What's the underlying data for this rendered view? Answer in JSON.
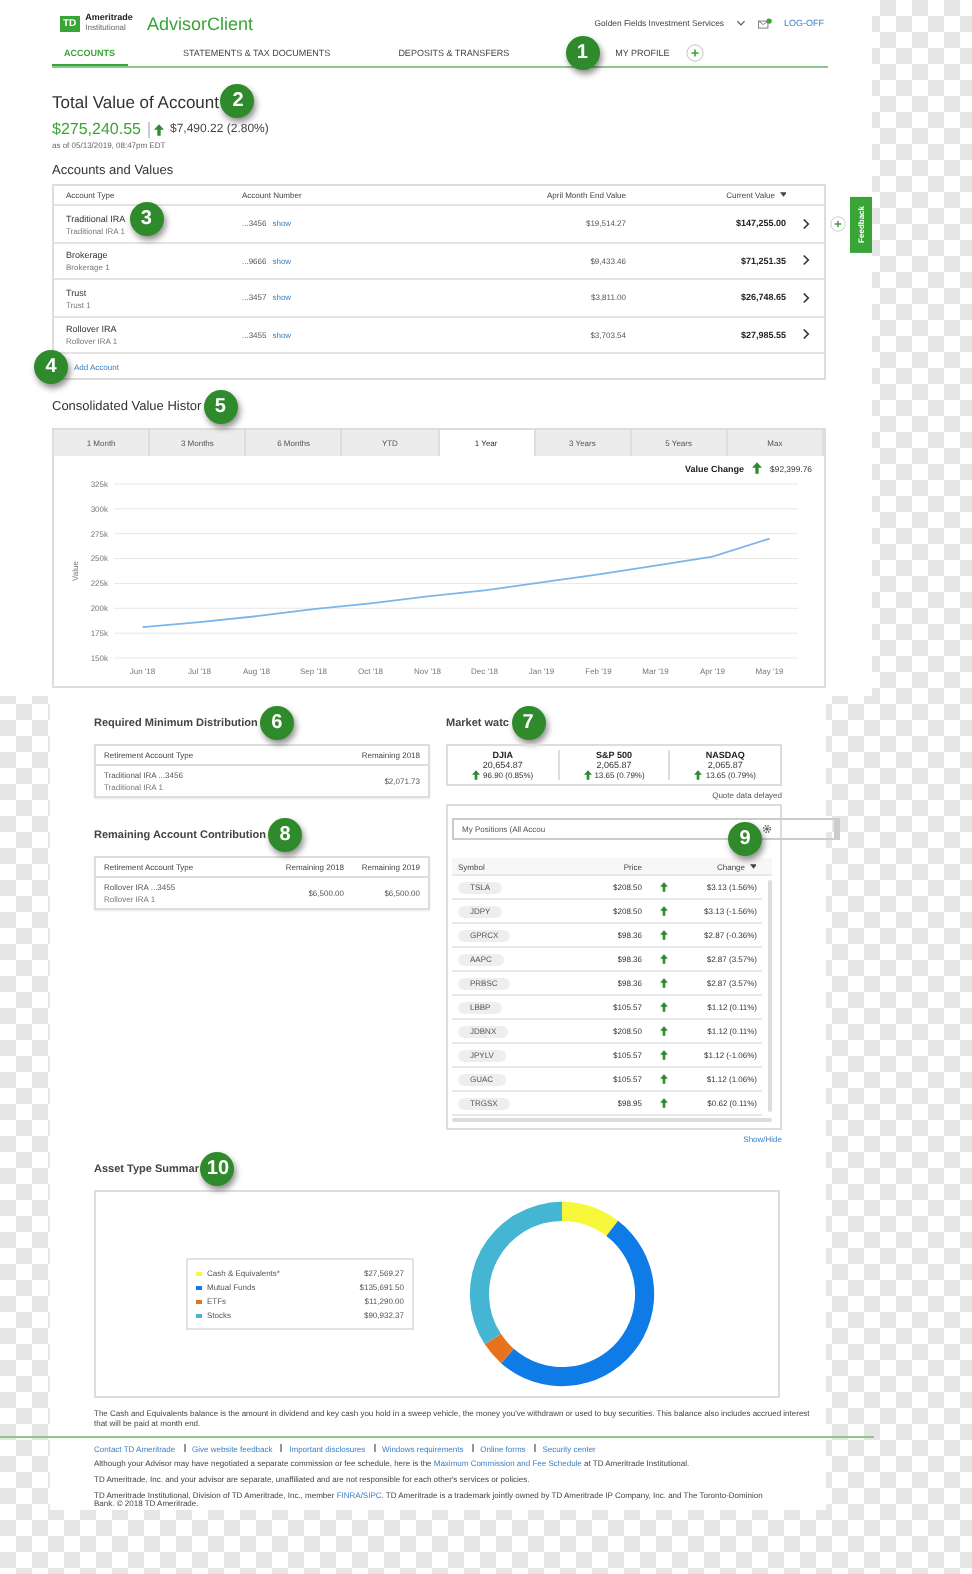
{
  "header": {
    "logo_mark": "TD",
    "logo_brand": "Ameritrade",
    "logo_sub": "Institutional",
    "app_name": "AdvisorClient",
    "firm": "Golden Fields Investment Services",
    "logoff": "LOG-OFF"
  },
  "nav": {
    "badge": "1",
    "tabs": [
      {
        "label": "ACCOUNTS",
        "selected": true
      },
      {
        "label": "STATEMENTS & TAX DOCUMENTS",
        "selected": false
      },
      {
        "label": "DEPOSITS & TRANSFERS",
        "selected": false
      },
      {
        "label": "MY PROFILE",
        "selected": false
      }
    ]
  },
  "total": {
    "title": "Total Value of Account",
    "badge": "2",
    "value": "$275,240.55",
    "change": "$7,490.22 (2.80%)",
    "up": true,
    "as_of": "as of 05/13/2019, 08:47pm EDT"
  },
  "feedback": "Feedback",
  "accounts": {
    "title": "Accounts and Values",
    "columns": [
      "Account Type",
      "Account Number",
      "April Month End Value",
      "Current Value"
    ],
    "rows": [
      {
        "type": "Traditional IRA",
        "nickname": "Traditional IRA 1",
        "number": "...3456",
        "show": "show",
        "april": "$19,514.27",
        "current": "$147,255.00",
        "badge": "3"
      },
      {
        "type": "Brokerage",
        "nickname": "Brokerage 1",
        "number": "...9666",
        "show": "show",
        "april": "$9,433.46",
        "current": "$71,251.35"
      },
      {
        "type": "Trust",
        "nickname": "Trust 1",
        "number": "...3457",
        "show": "show",
        "april": "$3,811.00",
        "current": "$26,748.65"
      },
      {
        "type": "Rollover IRA",
        "nickname": "Rollover IRA 1",
        "number": "...3455",
        "show": "show",
        "april": "$3,703.54",
        "current": "$27,985.55"
      }
    ],
    "add_badge": "4",
    "add_link": "Add Account"
  },
  "history": {
    "title": "Consolidated Value Histor",
    "badge": "5",
    "periods": [
      {
        "label": "1 Month",
        "selected": false
      },
      {
        "label": "3 Months",
        "selected": false
      },
      {
        "label": "6 Months",
        "selected": false
      },
      {
        "label": "YTD",
        "selected": false
      },
      {
        "label": "1 Year",
        "selected": true
      },
      {
        "label": "3 Years",
        "selected": false
      },
      {
        "label": "5 Years",
        "selected": false
      },
      {
        "label": "Max",
        "selected": false
      }
    ],
    "value_change_label": "Value Change",
    "value_change": "$92,399.76",
    "up": true,
    "chart_data": {
      "type": "line",
      "ylabel": "Value",
      "ylim": [
        150,
        325
      ],
      "grid": true,
      "categories": [
        "Jun '18",
        "Jul '18",
        "Aug '18",
        "Sep '18",
        "Oct '18",
        "Nov '18",
        "Dec '18",
        "Jan '19",
        "Feb '19",
        "Mar '19",
        "Apr '19",
        "May '19"
      ],
      "yticks": [
        {
          "value": 150,
          "label": "150k"
        },
        {
          "value": 175,
          "label": "175k"
        },
        {
          "value": 200,
          "label": "200k"
        },
        {
          "value": 225,
          "label": "225k"
        },
        {
          "value": 250,
          "label": "250k"
        },
        {
          "value": 275,
          "label": "275k"
        },
        {
          "value": 300,
          "label": "300k"
        },
        {
          "value": 325,
          "label": "325k"
        }
      ],
      "series": [
        {
          "color": "#7cb5ec",
          "values": [
            181,
            186,
            192,
            199,
            205,
            212,
            218,
            226,
            234,
            243,
            252,
            270
          ]
        }
      ]
    }
  },
  "rmd": {
    "title": "Required Minimum Distribution",
    "badge": "6",
    "columns": [
      "Retirement Account Type",
      "Remaining 2018"
    ],
    "rows": [
      {
        "account": "Traditional IRA ...3456",
        "nickname": "Traditional IRA 1",
        "values": [
          "$2,071.73"
        ]
      }
    ]
  },
  "contributions": {
    "title": "Remaining Account Contribution",
    "badge": "8",
    "columns": [
      "Retirement Account Type",
      "Remaining 2018",
      "Remaining 2019"
    ],
    "rows": [
      {
        "account": "Rollover IRA ...3455",
        "nickname": "Rollover IRA 1",
        "values": [
          "$6,500.00",
          "$6,500.00"
        ]
      }
    ]
  },
  "market": {
    "title": "Market watc",
    "badge": "7",
    "indices": [
      {
        "name": "DJIA",
        "value": "20,654.87",
        "change": "96.90 (0.85%)",
        "up": true
      },
      {
        "name": "S&P 500",
        "value": "2,065.87",
        "change": "13.65 (0.79%)",
        "up": true
      },
      {
        "name": "NASDAQ",
        "value": "2,065.87",
        "change": "13.65 (0.79%)",
        "up": true
      }
    ],
    "delayed": "Quote data delayed"
  },
  "positions": {
    "badge": "9",
    "dropdown": "My Positions (All Accou",
    "columns": [
      "Symbol",
      "Price",
      "Change"
    ],
    "rows": [
      {
        "symbol": "TSLA",
        "price": "$208.50",
        "up": true,
        "change": "$3.13 (1.56%)"
      },
      {
        "symbol": "JDPY",
        "price": "$208.50",
        "up": true,
        "change": "$3.13 (-1.56%)"
      },
      {
        "symbol": "GPRCX",
        "price": "$98.36",
        "up": true,
        "change": "$2.87 (-0.36%)"
      },
      {
        "symbol": "AAPC",
        "price": "$98.36",
        "up": true,
        "change": "$2.87 (3.57%)"
      },
      {
        "symbol": "PRBSC",
        "price": "$98.36",
        "up": true,
        "change": "$2.87 (3.57%)"
      },
      {
        "symbol": "LBBP",
        "price": "$105.57",
        "up": true,
        "change": "$1.12 (0.11%)"
      },
      {
        "symbol": "JDBNX",
        "price": "$208.50",
        "up": true,
        "change": "$1.12 (0.11%)"
      },
      {
        "symbol": "JPYLV",
        "price": "$105.57",
        "up": true,
        "change": "$1.12 (-1.06%)"
      },
      {
        "symbol": "GUAC",
        "price": "$105.57",
        "up": true,
        "change": "$1.12 (1.06%)"
      },
      {
        "symbol": "TRGSX",
        "price": "$98.95",
        "up": true,
        "change": "$0.62 (0.11%)"
      }
    ],
    "edit_link": "Show/Hide"
  },
  "asset": {
    "title": "Asset Type Summar",
    "badge": "10",
    "legend": [
      {
        "label": "Cash & Equivalents*",
        "value": "$27,569.27",
        "color": "#f7f73c"
      },
      {
        "label": "Mutual Funds",
        "value": "$135,691.50",
        "color": "#0f7be6"
      },
      {
        "label": "ETFs",
        "value": "$11,290.00",
        "color": "#e8731d"
      },
      {
        "label": "Stocks",
        "value": "$90,932.37",
        "color": "#44b6d3"
      }
    ],
    "chart_data": {
      "type": "donut",
      "values": [
        10.4,
        51.1,
        4.3,
        34.2
      ]
    }
  },
  "footnote": "The Cash and Equivalents balance is the amount in dividend and key cash you hold in a sweep vehicle, the money you've withdrawn or used to buy securities. This balance also includes accrued interest that will be paid at month end.",
  "footer_links": [
    "Contact TD Ameritrade",
    "Give website feedback",
    "Important disclosures",
    "Windows requirements",
    "Online forms",
    "Security center"
  ],
  "disclosures": [
    [
      {
        "text": "Although your Advisor may have negotiated a separate commission or fee schedule, here is the "
      },
      {
        "link": "Maximum Commission and Fee Schedule"
      },
      {
        "text": " at TD Ameritrade Institutional."
      }
    ],
    [
      {
        "text": "TD Ameritrade, Inc. and your advisor are separate, unaffiliated and are not responsible for each other's services or policies."
      }
    ],
    [
      {
        "text": "TD Ameritrade Institutional, Division of TD Ameritrade, Inc., member "
      },
      {
        "link": "FINRA/SIPC"
      },
      {
        "text": ". TD Ameritrade is a trademark jointly owned by TD Ameritrade IP Company, Inc. and The Toronto-Dominion Bank. © 2018 TD Ameritrade."
      }
    ]
  ]
}
